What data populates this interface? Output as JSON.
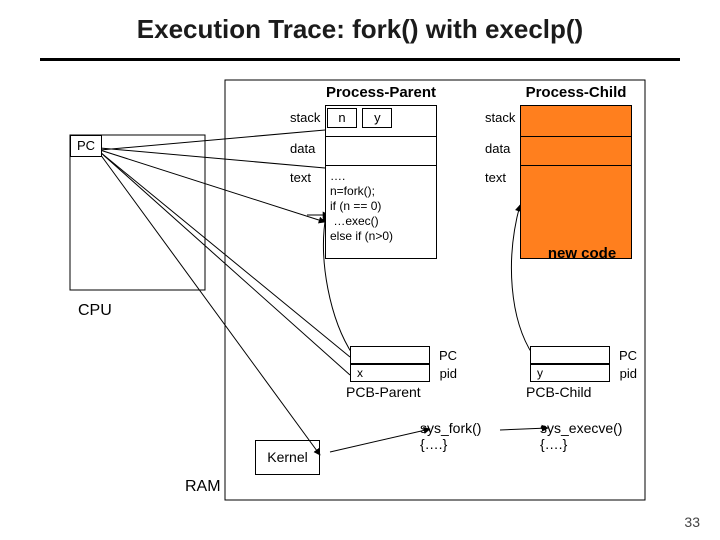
{
  "title": "Execution Trace: fork() with execlp()",
  "page_number": "33",
  "cpu": {
    "pc_label": "PC",
    "label": "CPU"
  },
  "ram": {
    "label": "RAM"
  },
  "parent": {
    "title": "Process-Parent",
    "stack_label": "stack",
    "stack_cell_n": "n",
    "stack_cell_y": "y",
    "data_label": "data",
    "text_label": "text",
    "code": "….\nn=fork();\nif (n == 0)\n …exec()\nelse if (n>0)"
  },
  "child": {
    "title": "Process-Child",
    "stack_label": "stack",
    "data_label": "data",
    "text_label": "text",
    "new_code_label": "new code"
  },
  "pcb_parent": {
    "pc_label": "PC",
    "pid_label": "pid",
    "pid_value": "x",
    "label": "PCB-Parent"
  },
  "pcb_child": {
    "pc_label": "PC",
    "pid_label": "pid",
    "pid_value": "y",
    "label": "PCB-Child"
  },
  "kernel": {
    "label": "Kernel"
  },
  "sys_fork": {
    "name": "sys_fork()",
    "body": "{….}"
  },
  "sys_exec": {
    "name": "sys_execve()",
    "body": "{….}"
  }
}
